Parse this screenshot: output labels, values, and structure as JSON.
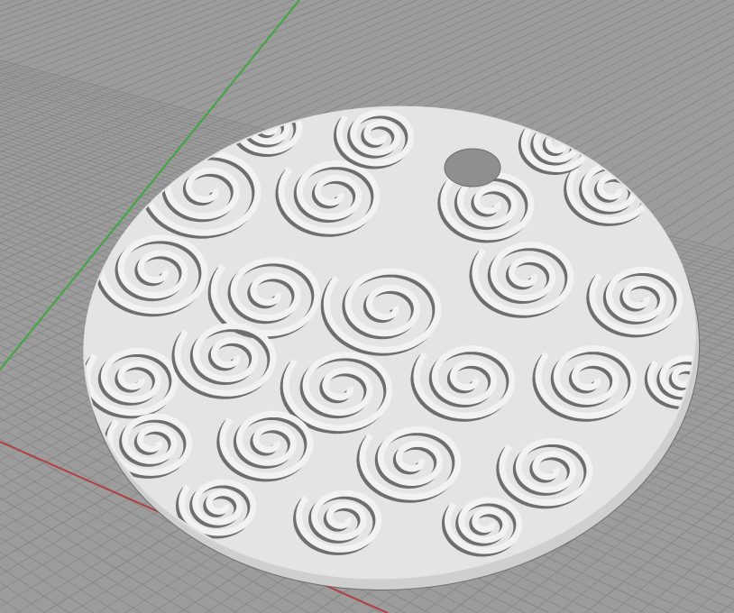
{
  "viewport": {
    "view": "perspective",
    "colors": {
      "background": "#9c9c9c",
      "grid_line": "#8a8a8a",
      "grid_major": "#858585",
      "axis_y": "#3fa63f",
      "axis_x": "#b04040",
      "model_face": "#e4e4e4",
      "model_edge": "#cfcfcf",
      "model_shadow": "#6e6e6e",
      "hole": "#8f8f8f"
    }
  },
  "model": {
    "name": "pendant-disc",
    "features": [
      "keyring-hole",
      "spiral-relief-pattern"
    ]
  }
}
